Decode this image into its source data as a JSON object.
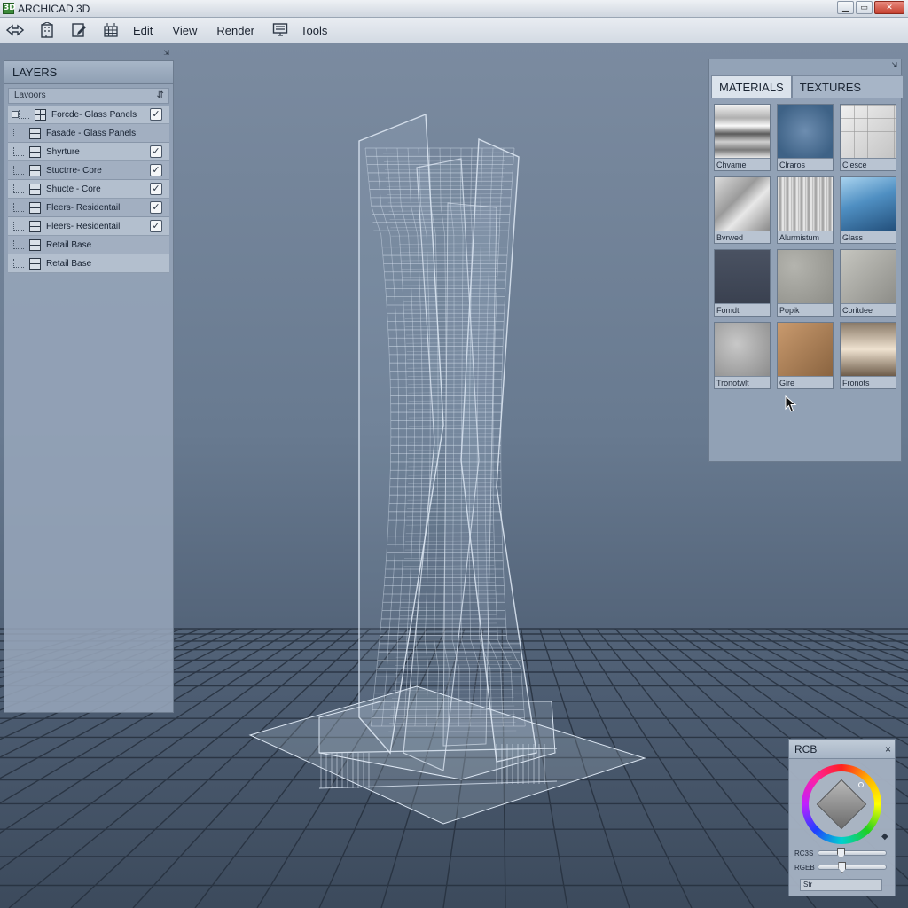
{
  "window": {
    "title": "ARCHICAD 3D",
    "app_icon": "3D",
    "controls": [
      "minimize",
      "maximize",
      "close"
    ]
  },
  "menubar": {
    "tool_icons": [
      "navigate-icon",
      "building-icon",
      "edit-doc-icon",
      "grid-tool-icon"
    ],
    "items": [
      "Edit",
      "View",
      "Render",
      "Tools"
    ],
    "trailing_icon": "monitor-icon"
  },
  "layers_panel": {
    "title": "LAYERS",
    "subheader": "Lavoors",
    "layers": [
      {
        "name": "Forcde- Glass Panels",
        "checked": true
      },
      {
        "name": "Fasade - Glass Panels",
        "checked": false
      },
      {
        "name": "Shyrture",
        "checked": true
      },
      {
        "name": "Stuctrre- Core",
        "checked": true
      },
      {
        "name": "Shucte - Core",
        "checked": true
      },
      {
        "name": "Fleers- Residentail",
        "checked": true
      },
      {
        "name": "Fleers- Residentail",
        "checked": true
      },
      {
        "name": "Retail Base",
        "checked": false
      },
      {
        "name": "Retail Base",
        "checked": false
      }
    ]
  },
  "materials_panel": {
    "tabs": [
      {
        "label": "MATERIALS",
        "active": true
      },
      {
        "label": "TEXTURES",
        "active": false
      }
    ],
    "materials": [
      {
        "label": "Chvame",
        "swatch": "sw-chrome"
      },
      {
        "label": "Clraros",
        "swatch": "sw-blue"
      },
      {
        "label": "Clesce",
        "swatch": "sw-tile"
      },
      {
        "label": "Bvrwed",
        "swatch": "sw-brushed"
      },
      {
        "label": "Alurmistum",
        "swatch": "sw-alum"
      },
      {
        "label": "Glass",
        "swatch": "sw-glass"
      },
      {
        "label": "Fomdt",
        "swatch": "sw-dark"
      },
      {
        "label": "Popik",
        "swatch": "sw-concrete"
      },
      {
        "label": "Coritdee",
        "swatch": "sw-concrete2"
      },
      {
        "label": "Tronotwlt",
        "swatch": "sw-granite"
      },
      {
        "label": "Gire",
        "swatch": "sw-copper"
      },
      {
        "label": "Fronots",
        "swatch": "sw-bronze"
      }
    ]
  },
  "rgb_panel": {
    "title": "RCB",
    "close": "×",
    "sliders": [
      {
        "label": "RC3S",
        "value": 0.3
      },
      {
        "label": "RGEB",
        "value": 0.32
      }
    ],
    "field": "Str"
  },
  "colors": {
    "viewport_top": "#7b8ba0",
    "viewport_bottom": "#3c4a5c",
    "wireframe": "#dce6f2",
    "grid": "#26303e"
  }
}
